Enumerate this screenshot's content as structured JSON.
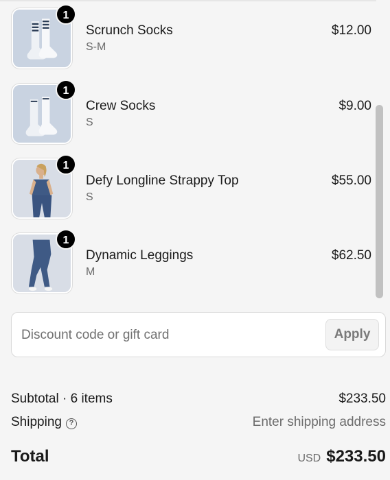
{
  "items": [
    {
      "name": "Scrunch Socks",
      "variant": "S-M",
      "price": "$12.00",
      "quantity": "1",
      "image": "scrunch-socks-image"
    },
    {
      "name": "Crew Socks",
      "variant": "S",
      "price": "$9.00",
      "quantity": "1",
      "image": "crew-socks-image"
    },
    {
      "name": "Defy Longline Strappy Top",
      "variant": "S",
      "price": "$55.00",
      "quantity": "1",
      "image": "strappy-top-image"
    },
    {
      "name": "Dynamic Leggings",
      "variant": "M",
      "price": "$62.50",
      "quantity": "1",
      "image": "leggings-image"
    }
  ],
  "discount": {
    "placeholder": "Discount code or gift card",
    "apply_label": "Apply"
  },
  "summary": {
    "subtotal_label": "Subtotal · 6 items",
    "subtotal_value": "$233.50",
    "shipping_label": "Shipping",
    "shipping_help_icon": "?",
    "shipping_value": "Enter shipping address",
    "total_label": "Total",
    "total_currency": "USD",
    "total_value": "$233.50"
  },
  "colors": {
    "background": "#f5f5f5",
    "badge": "#000000",
    "product_blue": "#3f5a85"
  }
}
